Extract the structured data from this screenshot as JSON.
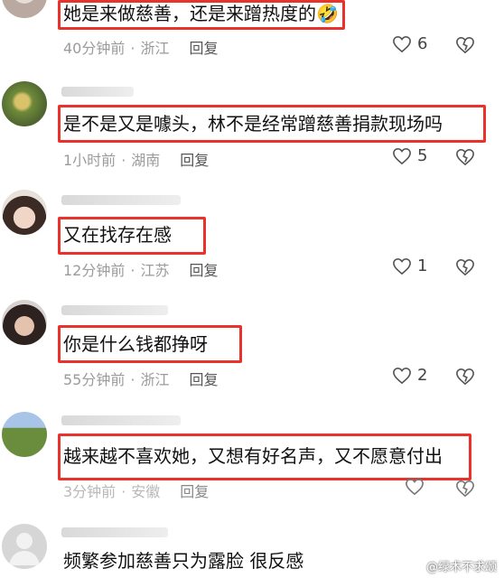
{
  "comments": [
    {
      "text": "她是来做慈善，还是来蹭热度的🤣",
      "time": "40分钟前",
      "location": "浙江",
      "reply": "回复",
      "likes": "6",
      "avatar_colors": [
        "#b9a9a0",
        "#e6ddd6"
      ]
    },
    {
      "text": "是不是又是噱头，林不是经常蹭慈善捐款现场吗",
      "time": "1小时前",
      "location": "湖南",
      "reply": "回复",
      "likes": "5",
      "avatar_colors": [
        "#6f8a3a",
        "#c9b96a"
      ]
    },
    {
      "text": "又在找存在感",
      "time": "12分钟前",
      "location": "江苏",
      "reply": "回复",
      "likes": "1",
      "avatar_colors": [
        "#3b2b24",
        "#f0d6c6"
      ]
    },
    {
      "text": "你是什么钱都挣呀",
      "time": "55分钟前",
      "location": "浙江",
      "reply": "回复",
      "likes": "2",
      "avatar_colors": [
        "#2d2220",
        "#e3c2ae"
      ]
    },
    {
      "text": "越来越不喜欢她，又想有好名声，又不愿意付出",
      "time": "3分钟前",
      "location": "安徽",
      "reply": "回复",
      "likes": "",
      "avatar_colors": [
        "#6a8d3d",
        "#a8c4e6"
      ]
    },
    {
      "text": "频繁参加慈善只为露脸  很反感",
      "time": "",
      "location": "",
      "reply": "",
      "likes": "",
      "avatar_colors": [
        "#c4c4c4",
        "#e6e6e6"
      ]
    }
  ],
  "watermark": "@绿术不求颂"
}
